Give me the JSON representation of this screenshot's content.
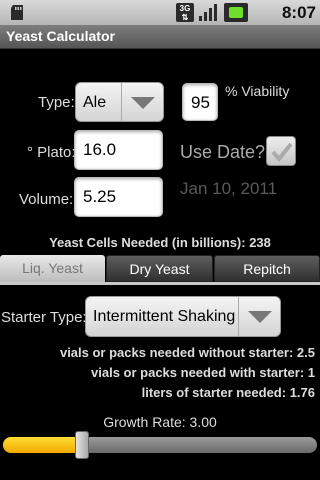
{
  "status_bar": {
    "time": "8:07 PM",
    "network": "3G",
    "icons": [
      "sd-card-icon",
      "network-3g-icon",
      "signal-icon",
      "battery-charging-icon"
    ]
  },
  "app": {
    "title": "Yeast Calculator"
  },
  "form": {
    "type_label": "Type:",
    "type_value": "Ale",
    "viability_value": "95",
    "viability_label": "% Viability",
    "plato_label": "° Plato:",
    "plato_value": "16.0",
    "use_date_label": "Use Date?",
    "use_date_checked": true,
    "volume_label": "Volume:",
    "volume_value": "5.25",
    "date_value": "Jan 10, 2011"
  },
  "cells_needed": "Yeast Cells Needed (in billions): 238",
  "tabs": [
    {
      "label": "Liq. Yeast",
      "active": true
    },
    {
      "label": "Dry Yeast",
      "active": false
    },
    {
      "label": "Repitch",
      "active": false
    }
  ],
  "starter": {
    "label": "Starter Type:",
    "value": "Intermittent Shaking"
  },
  "results": [
    "vials or packs needed without starter: 2.5",
    "vials or packs needed with starter: 1",
    "liters of starter needed: 1.76"
  ],
  "growth": {
    "label": "Growth Rate: 3.00",
    "slider_fraction": 0.25
  },
  "colors": {
    "slider_fill": "#f5b800",
    "date_text": "#5a5a5a",
    "titlebar": "#6a6a6a"
  }
}
